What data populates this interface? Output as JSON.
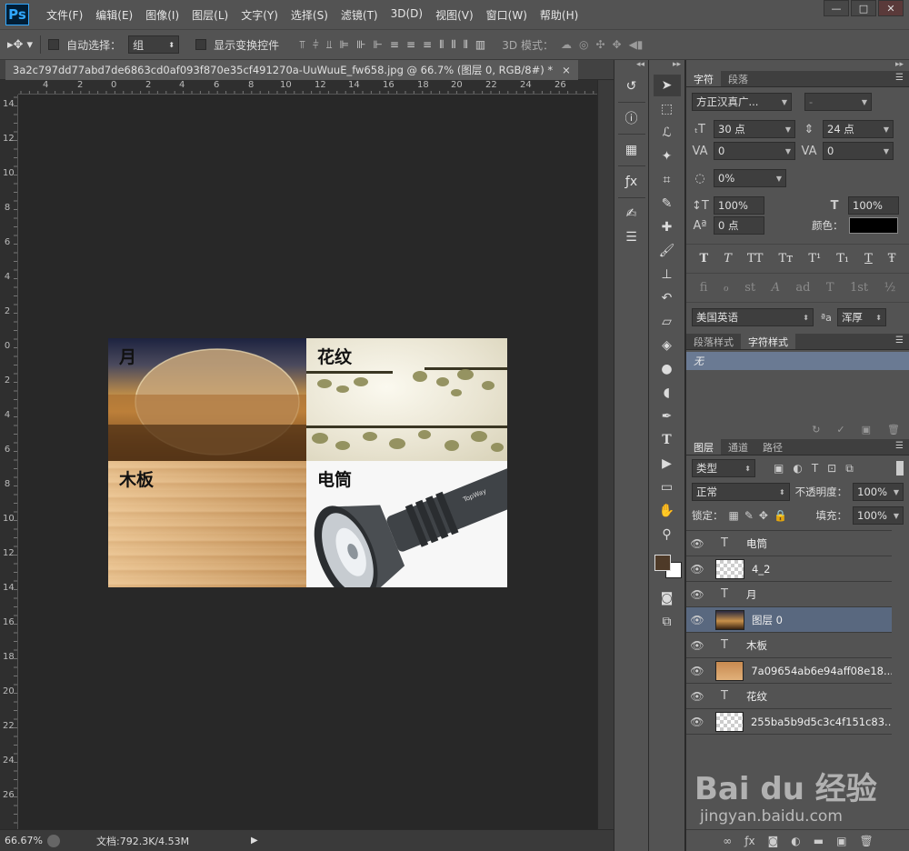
{
  "app": {
    "logo": "Ps"
  },
  "menu": [
    "文件(F)",
    "编辑(E)",
    "图像(I)",
    "图层(L)",
    "文字(Y)",
    "选择(S)",
    "滤镜(T)",
    "3D(D)",
    "视图(V)",
    "窗口(W)",
    "帮助(H)"
  ],
  "window_controls": {
    "minimize": "—",
    "maximize": "□",
    "close": "✕"
  },
  "options": {
    "auto_select_label": "自动选择：",
    "auto_select_value": "组",
    "show_transform_label": "显示变换控件",
    "mode_label": "3D 模式："
  },
  "document": {
    "tab_title": "3a2c797dd77abd7de6863cd0af093f870e35cf491270a-UuWuuE_fw658.jpg @ 66.7% (图层 0, RGB/8#) *",
    "tab_close": "×",
    "quadrant_labels": {
      "moon": "月",
      "pattern": "花纹",
      "wood": "木板",
      "flashlight": "电筒"
    },
    "flashlight_brand": "TopWay"
  },
  "rulers": {
    "top": [
      "4",
      "2",
      "0",
      "2",
      "4",
      "6",
      "8",
      "10",
      "12",
      "14",
      "16",
      "18",
      "20",
      "22",
      "24",
      "26"
    ],
    "left": [
      "14",
      "12",
      "10",
      "8",
      "6",
      "4",
      "2",
      "0",
      "2",
      "4",
      "6",
      "8",
      "10",
      "12",
      "14",
      "16",
      "18",
      "20",
      "22",
      "24",
      "26"
    ]
  },
  "status": {
    "zoom": "66.67%",
    "doc_info": "文档:792.3K/4.53M"
  },
  "character_panel": {
    "tabs": [
      "字符",
      "段落"
    ],
    "font_family": "方正汉真广...",
    "font_style": "-",
    "font_size": "30 点",
    "leading": "24 点",
    "kerning": "0",
    "tracking": "0",
    "tsume": "0%",
    "vertical_scale": "100%",
    "horizontal_scale": "100%",
    "baseline_shift": "0 点",
    "color_label": "颜色：",
    "color_value": "#000000",
    "style_buttons": [
      "T",
      "T",
      "TT",
      "Tт",
      "T¹",
      "T₁",
      "T",
      "Ŧ"
    ],
    "opentype_buttons": [
      "fi",
      "ℴ",
      "st",
      "A",
      "ad",
      "T",
      "1st",
      "½"
    ],
    "language": "美国英语",
    "aa_label": "ªa",
    "antialias": "浑厚"
  },
  "styles_panel": {
    "tabs": [
      "段落样式",
      "字符样式"
    ],
    "item": "无"
  },
  "layers_panel": {
    "tabs": [
      "图层",
      "通道",
      "路径"
    ],
    "filter_kind": "类型",
    "blend_mode": "正常",
    "opacity_label": "不透明度：",
    "opacity_value": "100%",
    "lock_label": "锁定：",
    "fill_label": "填充：",
    "fill_value": "100%",
    "layers": [
      {
        "name": "电筒",
        "type": "text",
        "selected": false
      },
      {
        "name": "4_2",
        "type": "smart",
        "selected": false
      },
      {
        "name": "月",
        "type": "text",
        "selected": false
      },
      {
        "name": "图层 0",
        "type": "image",
        "selected": true
      },
      {
        "name": "木板",
        "type": "text",
        "selected": false
      },
      {
        "name": "7a09654ab6e94aff08e18...",
        "type": "smart",
        "selected": false
      },
      {
        "name": "花纹",
        "type": "text",
        "selected": false
      },
      {
        "name": "255ba5b9d5c3c4f151c83...",
        "type": "smart",
        "selected": false
      }
    ]
  },
  "watermark": {
    "brand": "Bai du 经验",
    "url": "jingyan.baidu.com"
  }
}
